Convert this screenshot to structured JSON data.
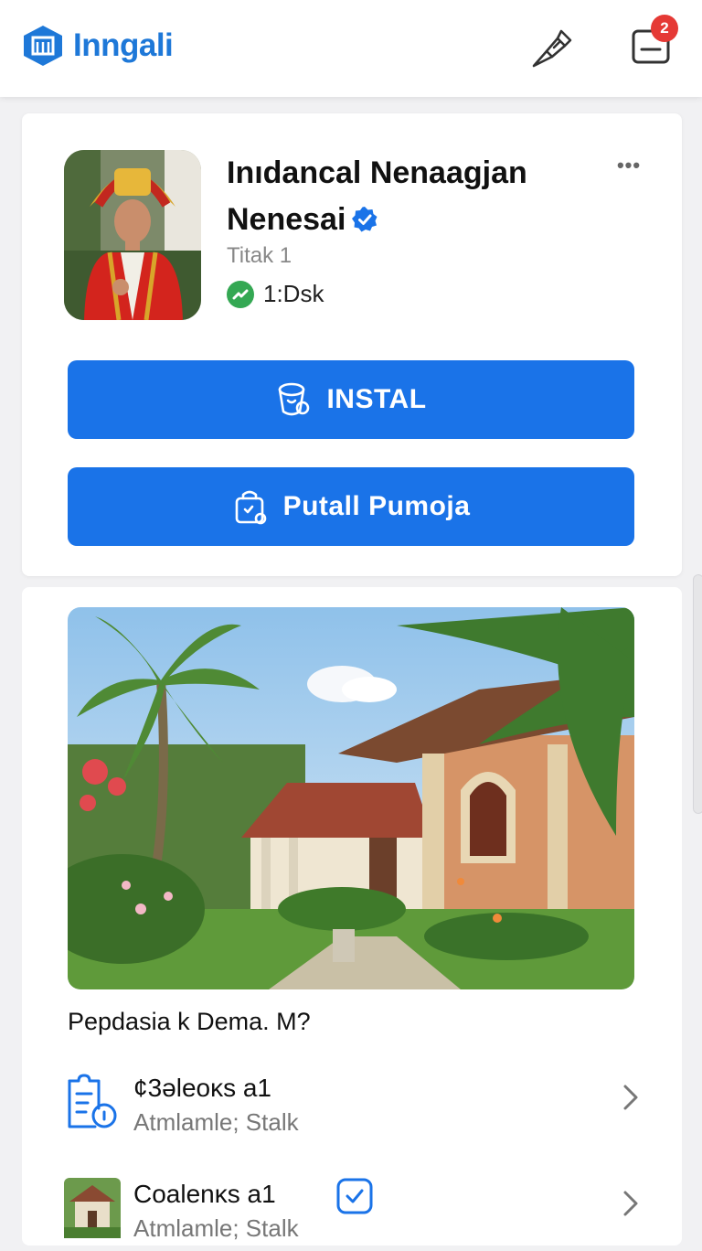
{
  "header": {
    "brand_name": "Inngali",
    "notification_count": "2"
  },
  "app": {
    "title_line1": "Inıdancal Nenaagjan",
    "title_line2": "Nenesai",
    "subtitle": "Titak 1",
    "stat": "1:Dsk",
    "install_label": "INSTAL",
    "purchase_label": "Putall Pumoja",
    "more_label": "•••"
  },
  "content": {
    "question": "Pepdasia k Dema. M?",
    "items": [
      {
        "title": "¢3əleoκs a1",
        "subtitle": "Atmlamle; Stalk",
        "icon": "document-info-icon"
      },
      {
        "title": "Coalenκs a1",
        "subtitle": "Atmlamle; Stalk",
        "icon": "house-thumbnail"
      }
    ]
  },
  "colors": {
    "brand": "#1e78d8",
    "primary_button": "#1a73e8",
    "badge": "#e53935",
    "success": "#34a853"
  }
}
